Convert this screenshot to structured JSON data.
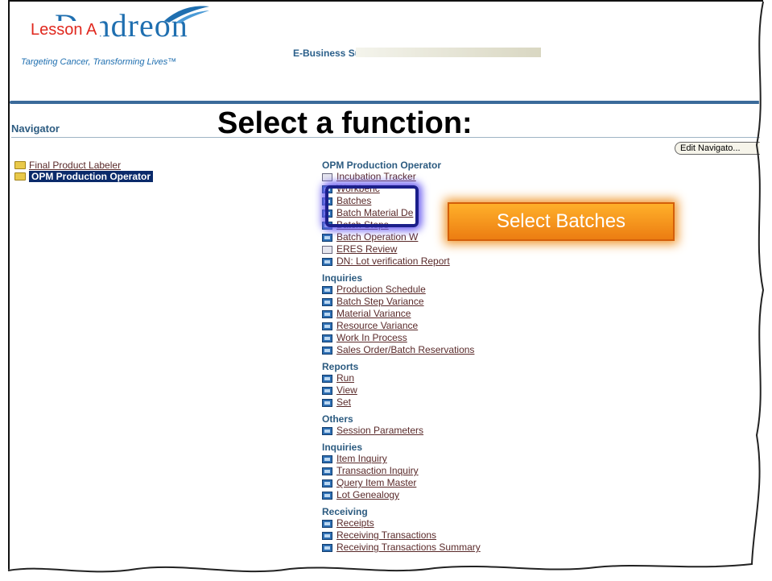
{
  "brand": {
    "lesson_label": "Lesson A",
    "logo_text": "Dendreon",
    "tagline": "Targeting Cancer, Transforming Lives™",
    "suite": "E-Business Suite",
    "color": "#1f6fb0"
  },
  "header": {
    "navigator_title": "Navigator",
    "overlay_title": "Select a function:",
    "edit_button": "Edit Navigato..."
  },
  "left_menu": [
    {
      "label": "Final Product Labeler",
      "selected": false
    },
    {
      "label": "OPM Production Operator",
      "selected": true
    }
  ],
  "function_sections": [
    {
      "heading": "OPM Production Operator",
      "items": [
        {
          "label": "Incubation Tracker",
          "icon": "page-icon"
        },
        {
          "label": "Workbenc",
          "icon": "form-icon"
        },
        {
          "label": "Batches",
          "icon": "form-icon"
        },
        {
          "label": "Batch Material De",
          "icon": "form-icon"
        },
        {
          "label": "Batch Steps",
          "icon": "form-icon"
        },
        {
          "label": "Batch Operation W",
          "icon": "form-icon"
        },
        {
          "label": "ERES Review",
          "icon": "page-icon"
        },
        {
          "label": "DN: Lot verification Report",
          "icon": "form-icon"
        }
      ]
    },
    {
      "heading": "Inquiries",
      "items": [
        {
          "label": "Production Schedule",
          "icon": "form-icon"
        },
        {
          "label": "Batch Step Variance",
          "icon": "form-icon"
        },
        {
          "label": "Material Variance",
          "icon": "form-icon"
        },
        {
          "label": "Resource Variance",
          "icon": "form-icon"
        },
        {
          "label": "Work In Process",
          "icon": "form-icon"
        },
        {
          "label": "Sales Order/Batch Reservations",
          "icon": "form-icon"
        }
      ]
    },
    {
      "heading": "Reports",
      "items": [
        {
          "label": "Run",
          "icon": "form-icon"
        },
        {
          "label": "View",
          "icon": "form-icon"
        },
        {
          "label": "Set",
          "icon": "form-icon"
        }
      ]
    },
    {
      "heading": "Others",
      "items": [
        {
          "label": "Session Parameters",
          "icon": "form-icon"
        }
      ]
    },
    {
      "heading": "Inquiries",
      "items": [
        {
          "label": "Item Inquiry",
          "icon": "form-icon"
        },
        {
          "label": "Transaction Inquiry",
          "icon": "form-icon"
        },
        {
          "label": "Query Item Master",
          "icon": "form-icon"
        },
        {
          "label": "Lot Genealogy",
          "icon": "form-icon"
        }
      ]
    },
    {
      "heading": "Receiving",
      "items": [
        {
          "label": "Receipts",
          "icon": "form-icon"
        },
        {
          "label": "Receiving Transactions",
          "icon": "form-icon"
        },
        {
          "label": "Receiving Transactions Summary",
          "icon": "form-icon"
        }
      ]
    }
  ],
  "callout": {
    "label": "Select Batches",
    "color": "#ec7d12"
  },
  "colors": {
    "selected_bg": "#0a2a6a",
    "link": "#5a2a2a",
    "heading": "#2c5b80",
    "highlight": "#1b1f8a"
  }
}
